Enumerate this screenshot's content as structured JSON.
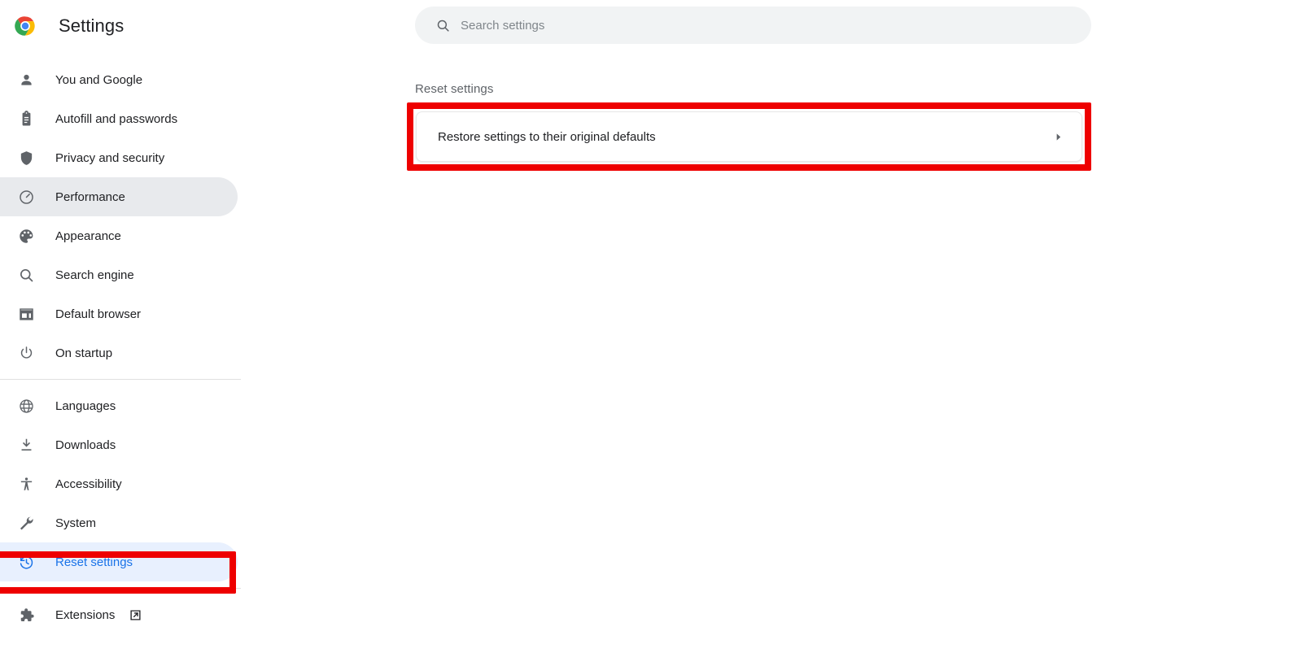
{
  "brand": {
    "logo_icon": "chrome-logo-icon",
    "title": "Settings"
  },
  "search": {
    "icon": "search-icon",
    "placeholder": "Search settings",
    "value": ""
  },
  "sidebar": {
    "groups": [
      {
        "items": [
          {
            "label": "You and Google",
            "icon": "person-icon",
            "state": "normal"
          },
          {
            "label": "Autofill and passwords",
            "icon": "clipboard-icon",
            "state": "normal"
          },
          {
            "label": "Privacy and security",
            "icon": "shield-icon",
            "state": "normal"
          },
          {
            "label": "Performance",
            "icon": "speedometer-icon",
            "state": "hovered"
          },
          {
            "label": "Appearance",
            "icon": "palette-icon",
            "state": "normal"
          },
          {
            "label": "Search engine",
            "icon": "magnifier-icon",
            "state": "normal"
          },
          {
            "label": "Default browser",
            "icon": "browser-window-icon",
            "state": "normal"
          },
          {
            "label": "On startup",
            "icon": "power-icon",
            "state": "normal"
          }
        ]
      },
      {
        "items": [
          {
            "label": "Languages",
            "icon": "globe-icon",
            "state": "normal"
          },
          {
            "label": "Downloads",
            "icon": "download-icon",
            "state": "normal"
          },
          {
            "label": "Accessibility",
            "icon": "accessibility-icon",
            "state": "normal"
          },
          {
            "label": "System",
            "icon": "wrench-icon",
            "state": "normal"
          },
          {
            "label": "Reset settings",
            "icon": "history-icon",
            "state": "selected"
          }
        ]
      },
      {
        "items": [
          {
            "label": "Extensions",
            "icon": "puzzle-icon",
            "state": "normal",
            "trailing_icon": "external-link-icon"
          }
        ]
      }
    ]
  },
  "main": {
    "section_title": "Reset settings",
    "reset_card": {
      "label": "Restore settings to their original defaults",
      "chevron_icon": "chevron-right-icon"
    }
  },
  "annotations": {
    "color": "#ee0000",
    "boxes": [
      {
        "name": "restore-defaults-row-highlight"
      },
      {
        "name": "reset-settings-sidebar-highlight"
      }
    ]
  },
  "colors": {
    "accent_blue": "#1a73e8",
    "selected_bg": "#e8f0fe",
    "hover_bg": "#e8eaed",
    "search_bg": "#f1f3f4",
    "text_primary": "#202124",
    "text_secondary": "#5f6368",
    "divider": "#e0e0e0"
  }
}
